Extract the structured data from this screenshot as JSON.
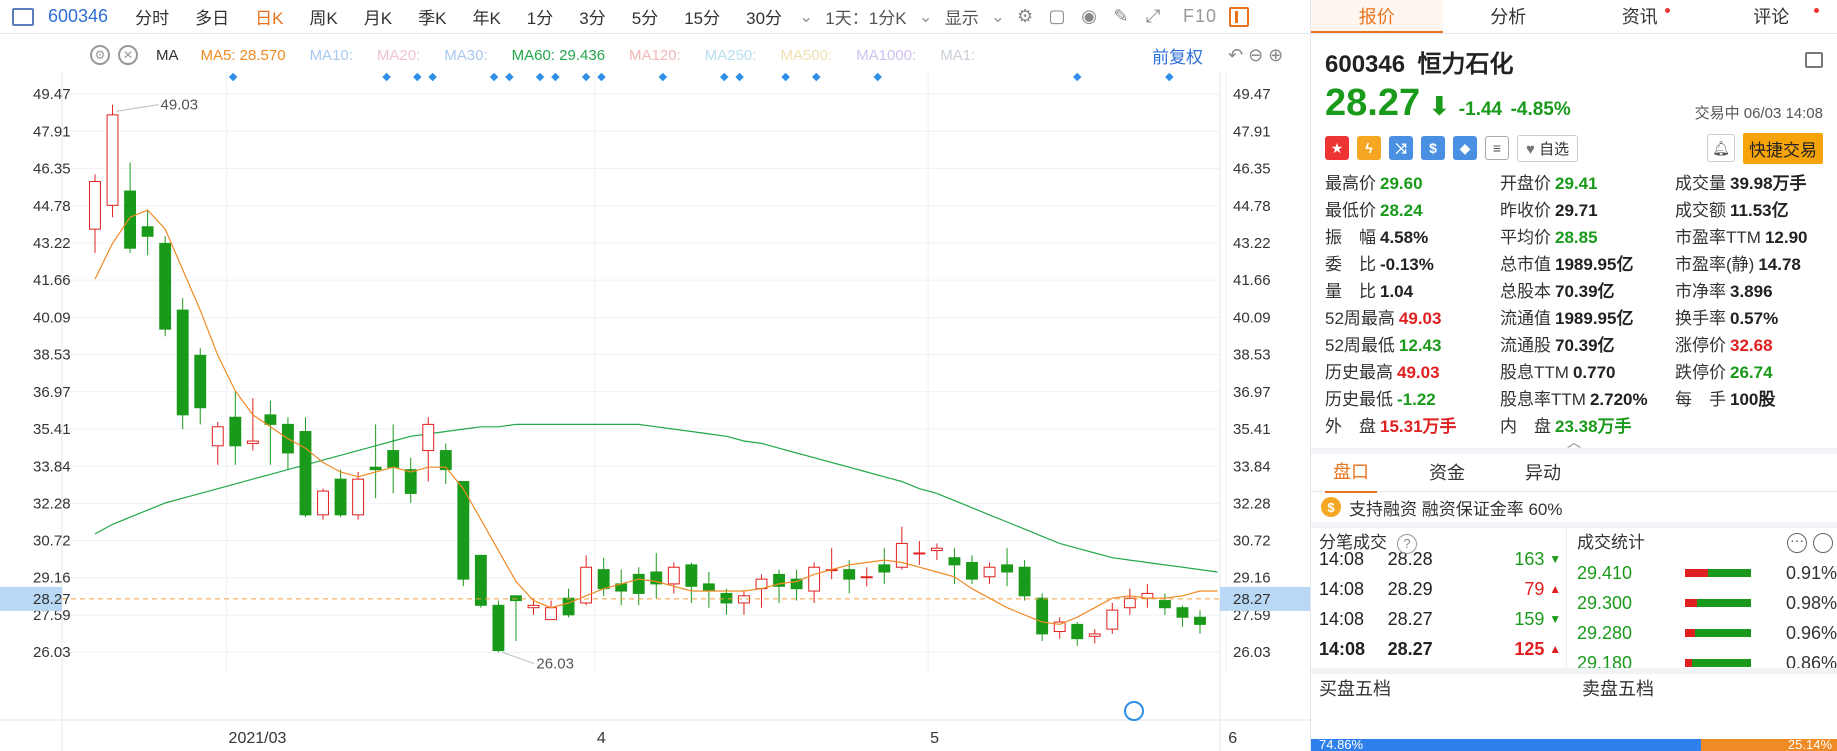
{
  "toolbar": {
    "code": "600346",
    "periods": [
      "分时",
      "多日",
      "日K",
      "周K",
      "月K",
      "季K",
      "年K",
      "1分",
      "3分",
      "5分",
      "15分",
      "30分"
    ],
    "active_period": "日K",
    "combo": "1天：1分K",
    "display": "显示",
    "f10": "F10"
  },
  "ma_row": {
    "label": "MA",
    "items": [
      {
        "text": "MA5: 28.570",
        "color": "#f08a24"
      },
      {
        "text": "MA10:",
        "color": "#a8c8f0"
      },
      {
        "text": "MA20:",
        "color": "#f0c0d8"
      },
      {
        "text": "MA30:",
        "color": "#a8c8f0"
      },
      {
        "text": "MA60: 29.436",
        "color": "#22a84a"
      },
      {
        "text": "MA120:",
        "color": "#f0b8b8"
      },
      {
        "text": "MA250:",
        "color": "#b8e0f0"
      },
      {
        "text": "MA500:",
        "color": "#f0e0b0"
      },
      {
        "text": "MA1000:",
        "color": "#d0c0f0"
      },
      {
        "text": "MA1:",
        "color": "#c8d0d8"
      }
    ],
    "adjust": "前复权"
  },
  "chart_data": {
    "type": "candlestick",
    "y_ticks": [
      "49.47",
      "47.91",
      "46.35",
      "44.78",
      "43.22",
      "41.66",
      "40.09",
      "38.53",
      "36.97",
      "35.41",
      "33.84",
      "32.28",
      "30.72",
      "29.16",
      "27.59",
      "26.03"
    ],
    "ylim": [
      25.2,
      50.4
    ],
    "x_labels": [
      {
        "text": "2021/03",
        "index": 8
      },
      {
        "text": "4",
        "index": 29
      },
      {
        "text": "5",
        "index": 48
      },
      {
        "text": "6",
        "index": 65
      }
    ],
    "current_price": "28.27",
    "high_label": "49.03",
    "low_label": "26.03",
    "candles": [
      [
        43.8,
        45.8,
        42.8,
        46.1
      ],
      [
        44.8,
        48.6,
        44.3,
        49.03
      ],
      [
        45.4,
        43.0,
        42.8,
        46.6
      ],
      [
        43.9,
        43.5,
        42.7,
        44.6
      ],
      [
        43.2,
        39.6,
        39.3,
        43.5
      ],
      [
        40.4,
        36.0,
        35.4,
        40.9
      ],
      [
        38.5,
        36.3,
        35.6,
        38.8
      ],
      [
        34.7,
        35.5,
        33.9,
        35.7
      ],
      [
        35.9,
        34.7,
        33.9,
        37.0
      ],
      [
        34.8,
        34.9,
        34.5,
        36.7
      ],
      [
        36.0,
        35.6,
        33.9,
        36.6
      ],
      [
        35.6,
        34.4,
        33.7,
        35.9
      ],
      [
        35.3,
        31.8,
        31.7,
        35.9
      ],
      [
        31.8,
        32.8,
        31.6,
        32.9
      ],
      [
        33.3,
        31.8,
        31.7,
        33.7
      ],
      [
        31.8,
        33.3,
        31.6,
        33.6
      ],
      [
        33.8,
        33.7,
        32.5,
        35.6
      ],
      [
        34.5,
        33.8,
        32.7,
        35.6
      ],
      [
        33.7,
        32.7,
        32.3,
        34.2
      ],
      [
        34.5,
        35.6,
        33.2,
        35.9
      ],
      [
        34.5,
        33.7,
        33.1,
        34.8
      ],
      [
        33.2,
        29.1,
        28.8,
        33.2
      ],
      [
        30.1,
        28.0,
        27.9,
        30.1
      ],
      [
        28.0,
        26.1,
        26.03,
        28.2
      ],
      [
        28.4,
        28.2,
        26.5,
        28.4
      ],
      [
        27.9,
        28.0,
        27.6,
        28.3
      ],
      [
        27.4,
        27.9,
        27.5,
        28.2
      ],
      [
        28.3,
        27.6,
        27.5,
        28.7
      ],
      [
        28.1,
        29.6,
        28.0,
        30.1
      ],
      [
        29.5,
        28.7,
        28.4,
        30.0
      ],
      [
        28.9,
        28.6,
        28.0,
        29.5
      ],
      [
        29.3,
        28.5,
        28.0,
        29.6
      ],
      [
        29.4,
        28.9,
        28.3,
        30.2
      ],
      [
        28.9,
        29.6,
        28.5,
        29.8
      ],
      [
        29.7,
        28.8,
        28.1,
        29.8
      ],
      [
        28.9,
        28.6,
        27.9,
        29.4
      ],
      [
        28.5,
        28.1,
        27.6,
        28.7
      ],
      [
        28.1,
        28.4,
        27.6,
        28.6
      ],
      [
        28.7,
        29.1,
        27.9,
        29.3
      ],
      [
        29.3,
        28.8,
        28.1,
        29.5
      ],
      [
        29.1,
        28.7,
        28.2,
        29.5
      ],
      [
        28.6,
        29.6,
        28.1,
        29.8
      ],
      [
        29.5,
        29.5,
        29.1,
        30.4
      ],
      [
        29.5,
        29.1,
        28.5,
        29.9
      ],
      [
        29.2,
        29.2,
        28.8,
        29.6
      ],
      [
        29.7,
        29.4,
        28.9,
        30.4
      ],
      [
        29.6,
        30.6,
        29.5,
        31.3
      ],
      [
        30.2,
        30.2,
        29.7,
        30.7
      ],
      [
        30.3,
        30.4,
        29.9,
        30.6
      ],
      [
        30.0,
        29.7,
        28.9,
        30.4
      ],
      [
        29.8,
        29.1,
        28.9,
        30.1
      ],
      [
        29.2,
        29.6,
        28.9,
        29.8
      ],
      [
        29.7,
        29.4,
        28.8,
        30.4
      ],
      [
        29.6,
        28.4,
        28.2,
        29.9
      ],
      [
        28.3,
        26.8,
        26.5,
        28.5
      ],
      [
        26.9,
        27.3,
        26.6,
        27.5
      ],
      [
        27.2,
        26.6,
        26.3,
        27.3
      ],
      [
        26.7,
        26.8,
        26.4,
        27.0
      ],
      [
        27.0,
        27.8,
        26.8,
        28.1
      ],
      [
        27.9,
        28.3,
        27.6,
        28.7
      ],
      [
        28.3,
        28.5,
        27.9,
        28.9
      ],
      [
        28.2,
        27.9,
        27.6,
        28.5
      ],
      [
        27.9,
        27.5,
        27.1,
        28.0
      ],
      [
        27.5,
        27.2,
        26.8,
        27.8
      ]
    ],
    "ma5": [
      41.7,
      43.2,
      44.3,
      44.6,
      43.8,
      42.1,
      40.4,
      38.5,
      37.0,
      36.0,
      35.5,
      35.0,
      34.6,
      34.0,
      33.6,
      33.4,
      33.6,
      33.8,
      33.6,
      33.8,
      33.8,
      32.9,
      31.6,
      30.3,
      29.0,
      28.2,
      27.9,
      28.1,
      28.4,
      28.7,
      28.9,
      29.1,
      29.0,
      28.8,
      28.6,
      28.6,
      28.6,
      28.6,
      28.7,
      28.9,
      29.0,
      29.3,
      29.5,
      29.7,
      29.8,
      29.9,
      29.8,
      29.6,
      29.4,
      29.2,
      28.7,
      28.3,
      27.9,
      27.6,
      27.3,
      27.2,
      27.5,
      27.9,
      28.3,
      28.4,
      28.3,
      28.3,
      28.4,
      28.6,
      28.6
    ],
    "ma60": [
      31.0,
      31.4,
      31.7,
      32.0,
      32.3,
      32.5,
      32.7,
      32.9,
      33.1,
      33.3,
      33.5,
      33.7,
      33.9,
      34.1,
      34.3,
      34.5,
      34.7,
      34.9,
      35.1,
      35.2,
      35.3,
      35.4,
      35.5,
      35.5,
      35.6,
      35.6,
      35.6,
      35.6,
      35.6,
      35.6,
      35.6,
      35.6,
      35.5,
      35.4,
      35.3,
      35.2,
      35.1,
      34.9,
      34.8,
      34.6,
      34.4,
      34.2,
      34.0,
      33.8,
      33.6,
      33.4,
      33.2,
      32.9,
      32.7,
      32.4,
      32.1,
      31.8,
      31.5,
      31.2,
      30.9,
      30.6,
      30.4,
      30.2,
      30.0,
      29.9,
      29.8,
      29.7,
      29.6,
      29.5,
      29.4
    ],
    "markers": [
      9,
      19,
      21,
      22,
      26,
      27,
      29,
      30,
      32,
      33,
      37,
      41,
      42,
      45,
      47,
      51,
      64,
      70
    ]
  },
  "panel": {
    "tabs": [
      {
        "label": "报价"
      },
      {
        "label": "分析"
      },
      {
        "label": "资讯"
      },
      {
        "label": "评论"
      }
    ],
    "code": "600346",
    "name": "恒力石化",
    "price": "28.27",
    "arrow": "⬇",
    "change": "-1.44",
    "change_pct": "-4.85%",
    "status": "交易中 06/03 14:08",
    "watch_label": "自选",
    "trade_btn": "快捷交易",
    "quote": [
      [
        {
          "l": "最高价",
          "v": "29.60",
          "c": "g"
        },
        {
          "l": "开盘价",
          "v": "29.41",
          "c": "g"
        },
        {
          "l": "成交量",
          "v": "39.98万手",
          "c": "k"
        }
      ],
      [
        {
          "l": "最低价",
          "v": "28.24",
          "c": "g"
        },
        {
          "l": "昨收价",
          "v": "29.71",
          "c": "k"
        },
        {
          "l": "成交额",
          "v": "11.53亿",
          "c": "k"
        }
      ],
      [
        {
          "l": "振　幅",
          "v": "4.58%",
          "c": "k"
        },
        {
          "l": "平均价",
          "v": "28.85",
          "c": "g"
        },
        {
          "l": "市盈率TTM",
          "v": "12.90",
          "c": "k"
        }
      ],
      [
        {
          "l": "委　比",
          "v": "-0.13%",
          "c": "k"
        },
        {
          "l": "总市值",
          "v": "1989.95亿",
          "c": "k"
        },
        {
          "l": "市盈率(静)",
          "v": "14.78",
          "c": "k"
        }
      ],
      [
        {
          "l": "量　比",
          "v": "1.04",
          "c": "k"
        },
        {
          "l": "总股本",
          "v": "70.39亿",
          "c": "k"
        },
        {
          "l": "市净率",
          "v": "3.896",
          "c": "k"
        }
      ],
      [
        {
          "l": "52周最高",
          "v": "49.03",
          "c": "r"
        },
        {
          "l": "流通值",
          "v": "1989.95亿",
          "c": "k"
        },
        {
          "l": "换手率",
          "v": "0.57%",
          "c": "k"
        }
      ],
      [
        {
          "l": "52周最低",
          "v": "12.43",
          "c": "g"
        },
        {
          "l": "流通股",
          "v": "70.39亿",
          "c": "k"
        },
        {
          "l": "涨停价",
          "v": "32.68",
          "c": "r"
        }
      ],
      [
        {
          "l": "历史最高",
          "v": "49.03",
          "c": "r"
        },
        {
          "l": "股息TTM",
          "v": "0.770",
          "c": "k"
        },
        {
          "l": "跌停价",
          "v": "26.74",
          "c": "g"
        }
      ],
      [
        {
          "l": "历史最低",
          "v": "-1.22",
          "c": "g"
        },
        {
          "l": "股息率TTM",
          "v": "2.720%",
          "c": "k"
        },
        {
          "l": "每　手",
          "v": "100股",
          "c": "k"
        }
      ],
      [
        {
          "l": "外　盘",
          "v": "15.31万手",
          "c": "r"
        },
        {
          "l": "内　盘",
          "v": "23.38万手",
          "c": "g"
        },
        {
          "l": "",
          "v": "",
          "c": "k"
        }
      ]
    ],
    "subtabs": [
      "盘口",
      "资金",
      "异动"
    ],
    "margin_text": "支持融资 融资保证金率 60%",
    "ticks_title": "分笔成交",
    "stats_title": "成交统计",
    "ticks": [
      {
        "t": "14:08",
        "p": "28.28",
        "v": "163",
        "d": "down",
        "bold": false
      },
      {
        "t": "14:08",
        "p": "28.29",
        "v": "79",
        "d": "up",
        "bold": false
      },
      {
        "t": "14:08",
        "p": "28.27",
        "v": "159",
        "d": "down",
        "bold": false
      },
      {
        "t": "14:08",
        "p": "28.27",
        "v": "125",
        "d": "up",
        "bold": true
      }
    ],
    "stats": [
      {
        "p": "29.410",
        "pct": "0.91%",
        "red": 0.35
      },
      {
        "p": "29.300",
        "pct": "0.98%",
        "red": 0.18
      },
      {
        "p": "29.280",
        "pct": "0.96%",
        "red": 0.15
      },
      {
        "p": "29.180",
        "pct": "0.86%",
        "red": 0.1
      }
    ],
    "book_buy": "买盘五档",
    "book_sell": "卖盘五档",
    "ratio_left": "74.86%",
    "ratio_right": "25.14%"
  }
}
